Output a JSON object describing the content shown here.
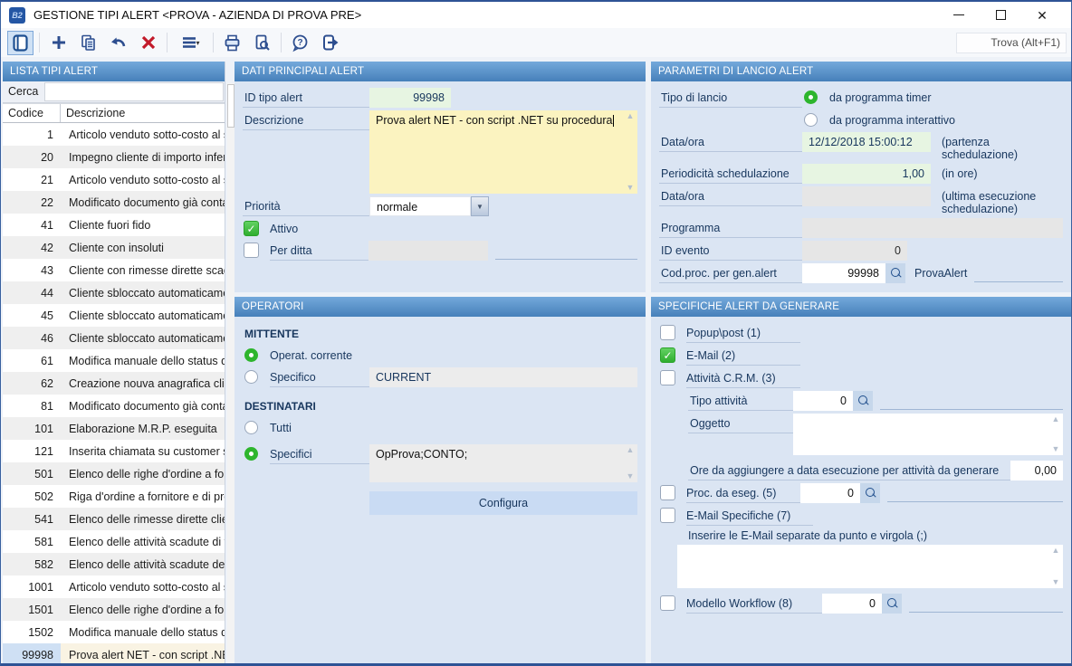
{
  "window": {
    "title": "GESTIONE TIPI ALERT <PROVA - AZIENDA DI PROVA PRE>",
    "logo_text": "B2"
  },
  "toolbar": {
    "find_value": "Trova (Alt+F1)",
    "buttons": [
      "list-toggle",
      "new",
      "copy",
      "undo",
      "delete",
      "menu",
      "print",
      "print-preview",
      "help",
      "exit"
    ]
  },
  "list_panel": {
    "title": "LISTA TIPI ALERT",
    "search_label": "Cerca",
    "search_value": "",
    "columns": {
      "code": "Codice",
      "desc": "Descrizione"
    },
    "selected_code": "99998",
    "rows": [
      {
        "code": "1",
        "desc": "Articolo venduto sotto-costo al s..."
      },
      {
        "code": "20",
        "desc": "Impegno cliente di importo inferio..."
      },
      {
        "code": "21",
        "desc": "Articolo venduto sotto-costo al s..."
      },
      {
        "code": "22",
        "desc": "Modificato documento già contabi..."
      },
      {
        "code": "41",
        "desc": "Cliente fuori fido"
      },
      {
        "code": "42",
        "desc": "Cliente con insoluti"
      },
      {
        "code": "43",
        "desc": "Cliente con rimesse dirette scadu..."
      },
      {
        "code": "44",
        "desc": "Cliente sbloccato automaticament..."
      },
      {
        "code": "45",
        "desc": "Cliente sbloccato automaticament..."
      },
      {
        "code": "46",
        "desc": "Cliente sbloccato automaticament..."
      },
      {
        "code": "61",
        "desc": "Modifica manuale dello status di '..."
      },
      {
        "code": "62",
        "desc": "Creazione nouva anagrafica clien..."
      },
      {
        "code": "81",
        "desc": "Modificato documento già contabi..."
      },
      {
        "code": "101",
        "desc": "Elaborazione M.R.P. eseguita"
      },
      {
        "code": "121",
        "desc": "Inserita chiamata su customer se..."
      },
      {
        "code": "501",
        "desc": "Elenco delle righe d'ordine a forni..."
      },
      {
        "code": "502",
        "desc": "Riga d'ordine a fornitore e di prod..."
      },
      {
        "code": "541",
        "desc": "Elenco delle rimesse dirette clienti..."
      },
      {
        "code": "581",
        "desc": "Elenco delle attività scadute di tu..."
      },
      {
        "code": "582",
        "desc": "Elenco delle attività scadute dell'o..."
      },
      {
        "code": "1001",
        "desc": "Articolo venduto sotto-costo al s..."
      },
      {
        "code": "1501",
        "desc": "Elenco delle righe d'ordine a forni..."
      },
      {
        "code": "1502",
        "desc": "Modifica manuale dello status di '..."
      },
      {
        "code": "99998",
        "desc": "Prova alert NET - con script .NET..."
      }
    ]
  },
  "dati_principali": {
    "title": "DATI PRINCIPALI ALERT",
    "id_label": "ID tipo alert",
    "id_value": "99998",
    "desc_label": "Descrizione",
    "desc_value": "Prova alert NET - con script .NET su procedura",
    "priority_label": "Priorità",
    "priority_value": "normale",
    "active_label": "Attivo",
    "active_checked": true,
    "per_ditta_label": "Per ditta",
    "per_ditta_checked": false,
    "per_ditta_value": ""
  },
  "operatori": {
    "title": "OPERATORI",
    "mittente_label": "MITTENTE",
    "op_corrente_label": "Operat. corrente",
    "op_corrente_selected": true,
    "specifico_label": "Specifico",
    "specifico_selected": false,
    "specifico_value": "CURRENT",
    "destinatari_label": "DESTINATARI",
    "tutti_label": "Tutti",
    "tutti_selected": false,
    "specifici_label": "Specifici",
    "specifici_selected": true,
    "specifici_value": "OpProva;CONTO;",
    "configura_label": "Configura"
  },
  "parametri": {
    "title": "PARAMETRI DI LANCIO ALERT",
    "tipo_label": "Tipo di lancio",
    "timer_label": "da programma timer",
    "timer_selected": true,
    "interattivo_label": "da programma interattivo",
    "interattivo_selected": false,
    "dataora1_label": "Data/ora",
    "dataora1_value": "12/12/2018 15:00:12",
    "dataora1_note": "(partenza schedulazione)",
    "periodicita_label": "Periodicità schedulazione",
    "periodicita_value": "1,00",
    "periodicita_note": "(in ore)",
    "dataora2_label": "Data/ora",
    "dataora2_value": "",
    "dataora2_note": "(ultima esecuzione schedulazione)",
    "programma_label": "Programma",
    "programma_value": "",
    "id_evento_label": "ID evento",
    "id_evento_value": "0",
    "codproc_label": "Cod.proc. per gen.alert",
    "codproc_value": "99998",
    "codproc_desc": "ProvaAlert"
  },
  "specifiche": {
    "title": "SPECIFICHE ALERT DA GENERARE",
    "popup_label": "Popup\\post (1)",
    "popup_checked": false,
    "email_label": "E-Mail (2)",
    "email_checked": true,
    "crm_label": "Attività C.R.M. (3)",
    "crm_checked": false,
    "tipo_attivita_label": "Tipo attività",
    "tipo_attivita_value": "0",
    "oggetto_label": "Oggetto",
    "oggetto_value": "",
    "ore_label": "Ore da aggiungere a data esecuzione per attività da generare",
    "ore_value": "0,00",
    "proc_label": "Proc. da eseg. (5)",
    "proc_checked": false,
    "proc_value": "0",
    "email_spec_label": "E-Mail Specifiche (7)",
    "email_spec_checked": false,
    "email_hint": "Inserire le E-Mail separate da  punto e virgola (;)",
    "email_list_value": "",
    "workflow_label": "Modello Workflow (8)",
    "workflow_checked": false,
    "workflow_value": "0"
  },
  "colors": {
    "panel_header_top": "#74a9db",
    "panel_header_bottom": "#4680ba",
    "field_green": "#e7f5e2",
    "field_yellow": "#fbf3c0",
    "field_gray": "#e6e6e6",
    "check_green": "#2fae2f",
    "selected_row_code": "#cfe0f4",
    "selected_row_desc": "#f9f3e3",
    "label_text": "#17365d",
    "delete_red": "#c21a2a",
    "toolbar_icon_blue": "#2d4e8f"
  }
}
